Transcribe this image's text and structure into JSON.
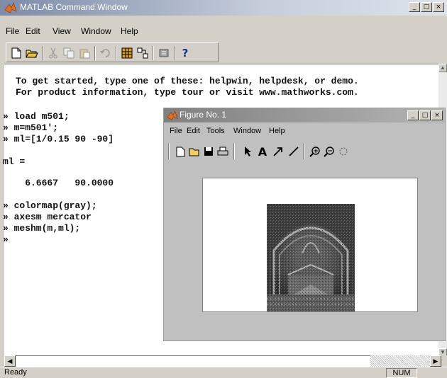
{
  "main_window": {
    "title": "MATLAB Command Window",
    "controls": {
      "minimize": "_",
      "maximize": "□",
      "close": "×"
    },
    "menu": [
      "File",
      "Edit",
      "View",
      "Window",
      "Help"
    ],
    "toolbar_icons": [
      "new-file-icon",
      "open-folder-icon",
      "cut-icon",
      "copy-icon",
      "paste-icon",
      "undo-icon",
      "workspace-icon",
      "path-icon",
      "simulink-icon",
      "help-icon"
    ]
  },
  "command": {
    "intro_line_1": "To get started, type one of these: helpwin, helpdesk, or demo.",
    "intro_line_2": "For product information, type tour or visit www.mathworks.com.",
    "lines": [
      "» load m501;",
      "» m=m501';",
      "» ml=[1/0.15 90 -90]",
      "",
      "ml =",
      "",
      "    6.6667   90.0000",
      "",
      "» colormap(gray);",
      "» axesm mercator",
      "» meshm(m,ml);",
      "»"
    ]
  },
  "figure_window": {
    "title": "Figure No. 1",
    "menu": [
      "File",
      "Edit",
      "Tools",
      "Window",
      "Help"
    ],
    "toolbar_icons": [
      "new-figure-icon",
      "open-icon",
      "save-icon",
      "print-icon",
      "select-arrow-icon",
      "insert-text-icon",
      "insert-arrow-icon",
      "insert-line-icon",
      "zoom-in-icon",
      "zoom-out-icon",
      "rotate-icon"
    ]
  },
  "status": {
    "text": "Ready",
    "num": "NUM"
  }
}
